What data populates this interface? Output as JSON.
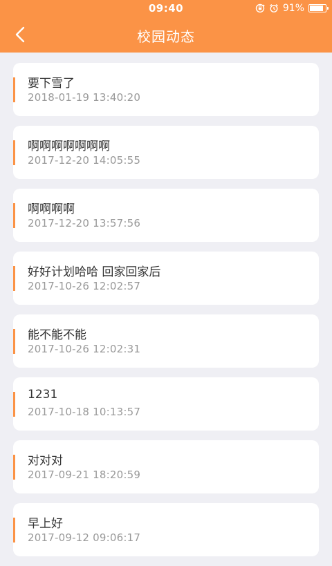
{
  "status_bar": {
    "time": "09:40",
    "battery_percent": "91%",
    "battery_level": 0.91,
    "icons": [
      "rotation-lock-icon",
      "alarm-clock-icon",
      "battery-icon"
    ]
  },
  "header": {
    "title": "校园动态",
    "back_icon": "chevron-left-icon",
    "background_color": "#fb9346"
  },
  "items": [
    {
      "title": "要下雪了",
      "time": "2018-01-19 13:40:20"
    },
    {
      "title": "啊啊啊啊啊啊啊",
      "time": "2017-12-20 14:05:55"
    },
    {
      "title": "啊啊啊啊",
      "time": "2017-12-20 13:57:56"
    },
    {
      "title": "好好计划哈哈 回家回家后",
      "time": "2017-10-26 12:02:57"
    },
    {
      "title": "能不能不能",
      "time": "2017-10-26 12:02:31"
    },
    {
      "title": "1231",
      "time": "2017-10-18 10:13:57"
    },
    {
      "title": "对对对",
      "time": "2017-09-21 18:20:59"
    },
    {
      "title": "早上好",
      "time": "2017-09-12 09:06:17"
    }
  ]
}
